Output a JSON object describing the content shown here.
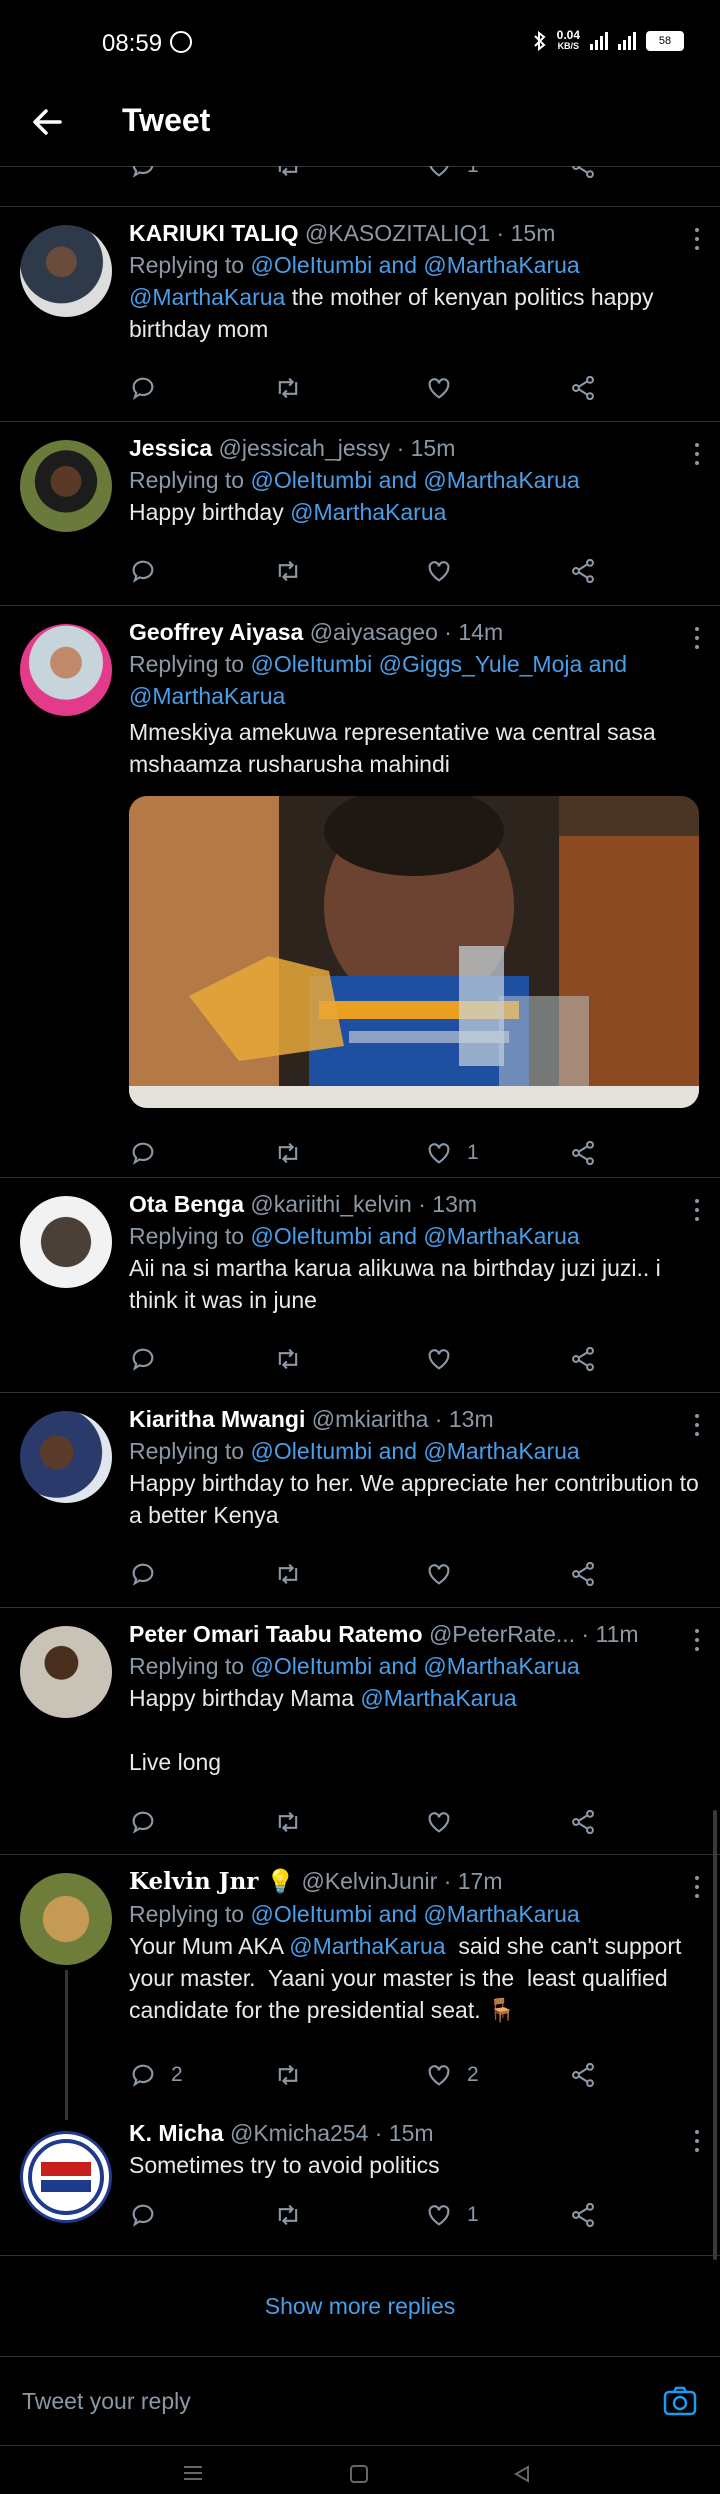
{
  "status_bar": {
    "time": "08:59",
    "speed_value": "0.04",
    "speed_unit": "KB/S",
    "battery": "58",
    "icons": [
      "whatsapp-icon",
      "bluetooth-icon",
      "signal-icon",
      "battery-icon"
    ]
  },
  "header": {
    "title": "Tweet",
    "back_icon": "back-arrow-icon"
  },
  "partial_tweet": {
    "like_count": "1"
  },
  "tweets": [
    {
      "name": "KARIUKI TALIQ",
      "handle": "@KASOZITALIQ1",
      "time": "15m",
      "replying_prefix": "Replying to",
      "replying_to": "@OleItumbi and @MarthaKarua",
      "mention": "@MarthaKarua",
      "text": " the mother of kenyan politics happy birthday mom",
      "reply_count": "",
      "retweet_count": "",
      "like_count": ""
    },
    {
      "name": "Jessica",
      "handle": "@jessicah_jessy",
      "time": "15m",
      "replying_prefix": "Replying to",
      "replying_to": "@OleItumbi and @MarthaKarua",
      "text": "Happy birthday ",
      "mention": "@MarthaKarua",
      "reply_count": "",
      "retweet_count": "",
      "like_count": ""
    },
    {
      "name": "Geoffrey Aiyasa",
      "handle": "@aiyasageo",
      "time": "14m",
      "replying_prefix": "Replying to",
      "replying_to": "@OleItumbi @Giggs_Yule_Moja and @MarthaKarua",
      "text": "Mmeskiya amekuwa representative wa central sasa mshaamza rusharusha mahindi",
      "has_media": true,
      "reply_count": "",
      "retweet_count": "",
      "like_count": "1"
    },
    {
      "name": "Ota Benga",
      "handle": "@kariithi_kelvin",
      "time": "13m",
      "replying_prefix": "Replying to",
      "replying_to": "@OleItumbi and @MarthaKarua",
      "text": "Aii na si martha karua alikuwa na birthday juzi juzi.. i think it was in june",
      "reply_count": "",
      "retweet_count": "",
      "like_count": ""
    },
    {
      "name": "Kiaritha Mwangi",
      "handle": "@mkiaritha",
      "time": "13m",
      "replying_prefix": "Replying to",
      "replying_to": "@OleItumbi and @MarthaKarua",
      "text": "Happy birthday to her. We appreciate her contribution to a better Kenya",
      "reply_count": "",
      "retweet_count": "",
      "like_count": ""
    },
    {
      "name": "Peter Omari Taabu Ratemo",
      "handle": "@PeterRate...",
      "time": "11m",
      "replying_prefix": "Replying to",
      "replying_to": "@OleItumbi and @MarthaKarua",
      "text": "Happy birthday Mama ",
      "mention": "@MarthaKarua",
      "text2": "Live long",
      "reply_count": "",
      "retweet_count": "",
      "like_count": ""
    },
    {
      "name": "Kelvin Jnr 💡",
      "handle": "@KelvinJunir",
      "time": "17m",
      "replying_prefix": "Replying to",
      "replying_to": "@OleItumbi and @MarthaKarua",
      "text": "Your Mum AKA ",
      "mention": "@MarthaKarua",
      "text2": "  said she can't support your master.  Yaani your master is the  least qualified candidate for the presidential seat. 🪑",
      "reply_count": "2",
      "retweet_count": "",
      "like_count": "2"
    },
    {
      "name": "K. Micha",
      "handle": "@Kmicha254",
      "time": "15m",
      "text": "Sometimes try to avoid politics",
      "reply_count": "",
      "retweet_count": "",
      "like_count": "1"
    }
  ],
  "show_more": "Show more replies",
  "reply_bar": {
    "placeholder": "Tweet your reply",
    "camera_icon": "camera-icon"
  },
  "colors": {
    "background": "#000000",
    "link": "#4a9ee8",
    "secondary_text": "#8b98a5",
    "divider": "#2f3336"
  }
}
